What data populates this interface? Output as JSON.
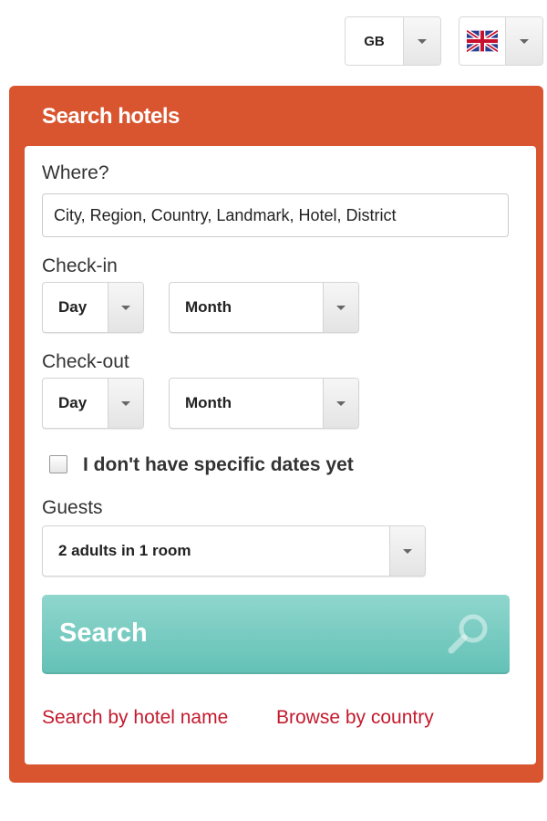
{
  "top_bar": {
    "region_value": "GB",
    "language_icon": "uk-flag-icon"
  },
  "panel": {
    "title": "Search hotels",
    "where_label": "Where?",
    "where_placeholder": "City, Region, Country, Landmark, Hotel, District",
    "checkin_label": "Check-in",
    "checkin_day": "Day",
    "checkin_month": "Month",
    "checkout_label": "Check-out",
    "checkout_day": "Day",
    "checkout_month": "Month",
    "no_dates_label": "I don't have specific dates yet",
    "no_dates_checked": false,
    "guests_label": "Guests",
    "guests_value": "2 adults in 1 room",
    "search_label": "Search",
    "link_hotel_name": "Search by hotel name",
    "link_browse_country": "Browse by country"
  },
  "colors": {
    "panel_bg": "#d9552f",
    "search_button": "#75c9bf",
    "link": "#c31a2d"
  }
}
